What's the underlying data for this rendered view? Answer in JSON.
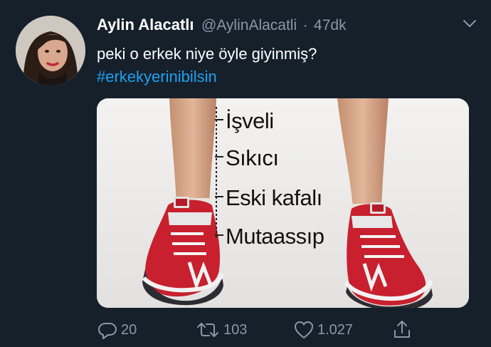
{
  "tweet": {
    "author_name": "Aylin Alacatlı",
    "handle": "@AylinAlacatli",
    "separator": "·",
    "time": "47dk",
    "text": "peki o erkek niye öyle giyinmiş?",
    "hashtag": "#erkekyerinibilsin"
  },
  "media": {
    "labels": [
      "İşveli",
      "Sıkıcı",
      "Eski kafalı",
      "Mutaassıp"
    ]
  },
  "actions": {
    "replies": "20",
    "retweets": "103",
    "likes": "1.027"
  },
  "colors": {
    "background": "#15202b",
    "secondary_text": "#8899a6",
    "link": "#1da1f2"
  }
}
